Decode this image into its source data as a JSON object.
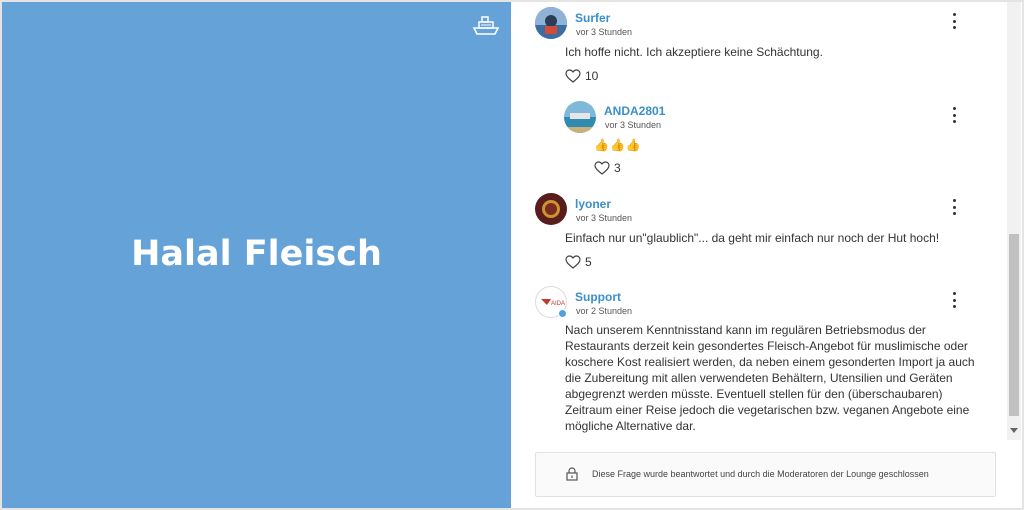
{
  "hero": {
    "title": "Halal Fleisch"
  },
  "comments": [
    {
      "author": "Surfer",
      "time": "vor 3 Stunden",
      "text": "Ich hoffe nicht. Ich akzeptiere keine Schächtung.",
      "likes": "10"
    },
    {
      "author": "ANDA2801",
      "time": "vor 3 Stunden",
      "text": "👍👍👍",
      "likes": "3"
    },
    {
      "author": "lyoner",
      "time": "vor 3 Stunden",
      "text": "Einfach nur un\"glaublich\"... da geht mir einfach nur noch der Hut hoch!",
      "likes": "5"
    },
    {
      "author": "Support",
      "time": "vor 2 Stunden",
      "text": "Nach unserem Kenntnisstand kann im regulären Betriebsmodus der Restaurants derzeit kein gesondertes Fleisch-Angebot für muslimische oder koschere Kost realisiert werden, da neben einem gesonderten Import ja auch die Zubereitung mit allen verwendeten Behältern, Utensilien und Geräten abgegrenzt werden müsste. Eventuell stellen für den (überschaubaren) Zeitraum einer Reise jedoch die vegetarischen bzw. veganen Angebote eine mögliche Alternative dar."
    }
  ],
  "closed_notice": "Diese Frage wurde beantwortet und durch die Moderatoren der Lounge geschlossen",
  "icons": [
    "ship-icon",
    "heart-icon",
    "kebab-menu-icon",
    "lock-icon",
    "verified-badge-icon"
  ],
  "colors": {
    "hero": "#65a2d8",
    "author": "#3b8fc9"
  }
}
